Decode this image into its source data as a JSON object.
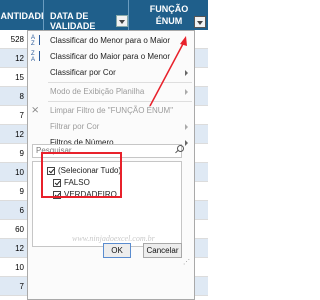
{
  "headers": {
    "quantity": "UANTIDADE",
    "date": "DATA DE VALIDADE",
    "function_line1": "FUNÇÃO",
    "function_line2": "ÉNUM"
  },
  "quantity_values": [
    "528",
    "12",
    "15",
    "8",
    "7",
    "12",
    "9",
    "10",
    "9",
    "6",
    "60",
    "12",
    "10",
    "7"
  ],
  "menu": {
    "sort_az": "Classificar do Menor para o Maior",
    "sort_za": "Classificar do Maior para o Menor",
    "sort_color": "Classificar por Cor",
    "sheet_view": "Modo de Exibição Planilha",
    "clear_filter": "Limpar Filtro de \"FUNÇÃO ÉNUM\"",
    "filter_color": "Filtrar por Cor",
    "number_filters": "Filtros de Número"
  },
  "search": {
    "placeholder": "Pesquisar"
  },
  "list": {
    "select_all": "(Selecionar Tudo)",
    "false_value": "FALSO",
    "true_value": "VERDADEIRO"
  },
  "buttons": {
    "ok": "OK",
    "cancel": "Cancelar"
  },
  "watermark": "www.ninjadoexcel.com.br",
  "colors": {
    "header": "#1f5f8b",
    "highlight": "#e8212b",
    "band": "#dfe9f4"
  }
}
